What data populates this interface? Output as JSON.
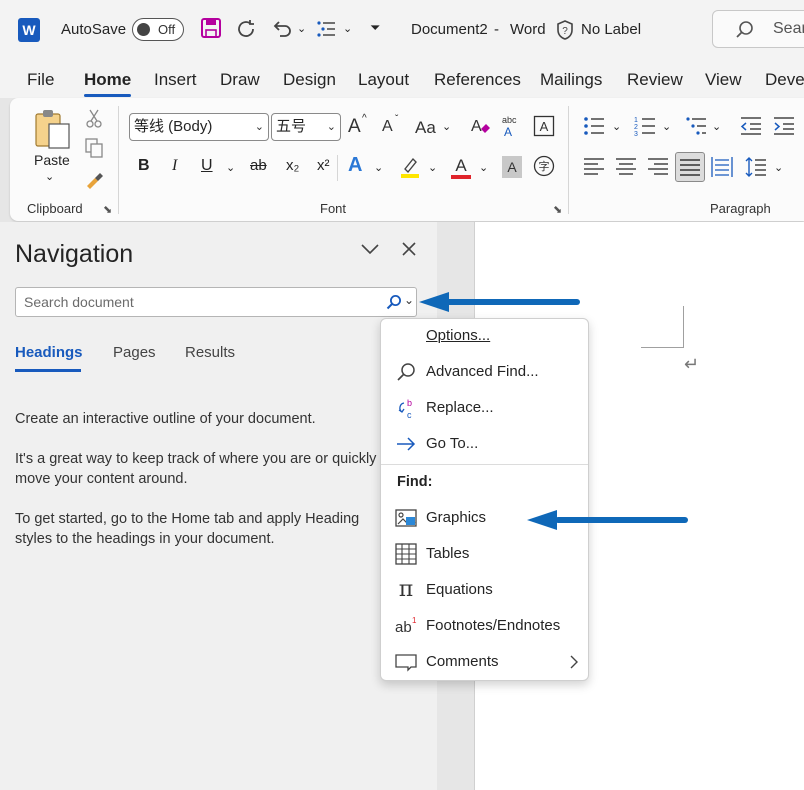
{
  "titlebar": {
    "app_letter": "W",
    "autosave_label": "AutoSave",
    "autosave_state": "Off",
    "document_title": "Document2",
    "separator": "-",
    "app_name": "Word",
    "sensitivity_label": "No Label",
    "search_placeholder": "Sear"
  },
  "ribbon_tabs": [
    "File",
    "Home",
    "Insert",
    "Draw",
    "Design",
    "Layout",
    "References",
    "Mailings",
    "Review",
    "View",
    "Deve"
  ],
  "ribbon": {
    "paste_label": "Paste",
    "clipboard_label": "Clipboard",
    "font_name": "等线 (Body)",
    "font_size": "五号",
    "font_label": "Font",
    "paragraph_label": "Paragraph",
    "bold": "B",
    "italic": "I",
    "underline": "U",
    "strike": "ab",
    "subscript": "x₂",
    "superscript": "x²",
    "grow_font": "A",
    "shrink_font": "A",
    "change_case": "Aa",
    "text_effects": "A",
    "highlight": "✎",
    "font_color": "A"
  },
  "navigation": {
    "title": "Navigation",
    "search_placeholder": "Search document",
    "tabs": [
      "Headings",
      "Pages",
      "Results"
    ],
    "paragraphs": [
      "Create an interactive outline of your document.",
      "It's a great way to keep track of where you are or quickly move your content around.",
      "To get started, go to the Home tab and apply Heading styles to the headings in your document."
    ]
  },
  "search_menu": {
    "items": [
      {
        "label": "Options...",
        "icon": "none"
      },
      {
        "label": "Advanced Find...",
        "icon": "magnifier-icon"
      },
      {
        "label": "Replace...",
        "icon": "replace-icon"
      },
      {
        "label": "Go To...",
        "icon": "arrow-right-icon"
      }
    ],
    "find_heading": "Find:",
    "find_items": [
      {
        "label": "Graphics",
        "icon": "graphics-icon"
      },
      {
        "label": "Tables",
        "icon": "table-icon"
      },
      {
        "label": "Equations",
        "icon": "pi-icon"
      },
      {
        "label": "Footnotes/Endnotes",
        "icon": "footnote-icon"
      },
      {
        "label": "Comments",
        "icon": "comment-icon"
      }
    ]
  },
  "document": {
    "paragraph_mark": "↵"
  },
  "colors": {
    "accent": "#185abd",
    "arrow": "#0f68b8",
    "save": "#b4009e",
    "highlight_yellow": "#ffe600",
    "font_red": "#e0242b"
  }
}
